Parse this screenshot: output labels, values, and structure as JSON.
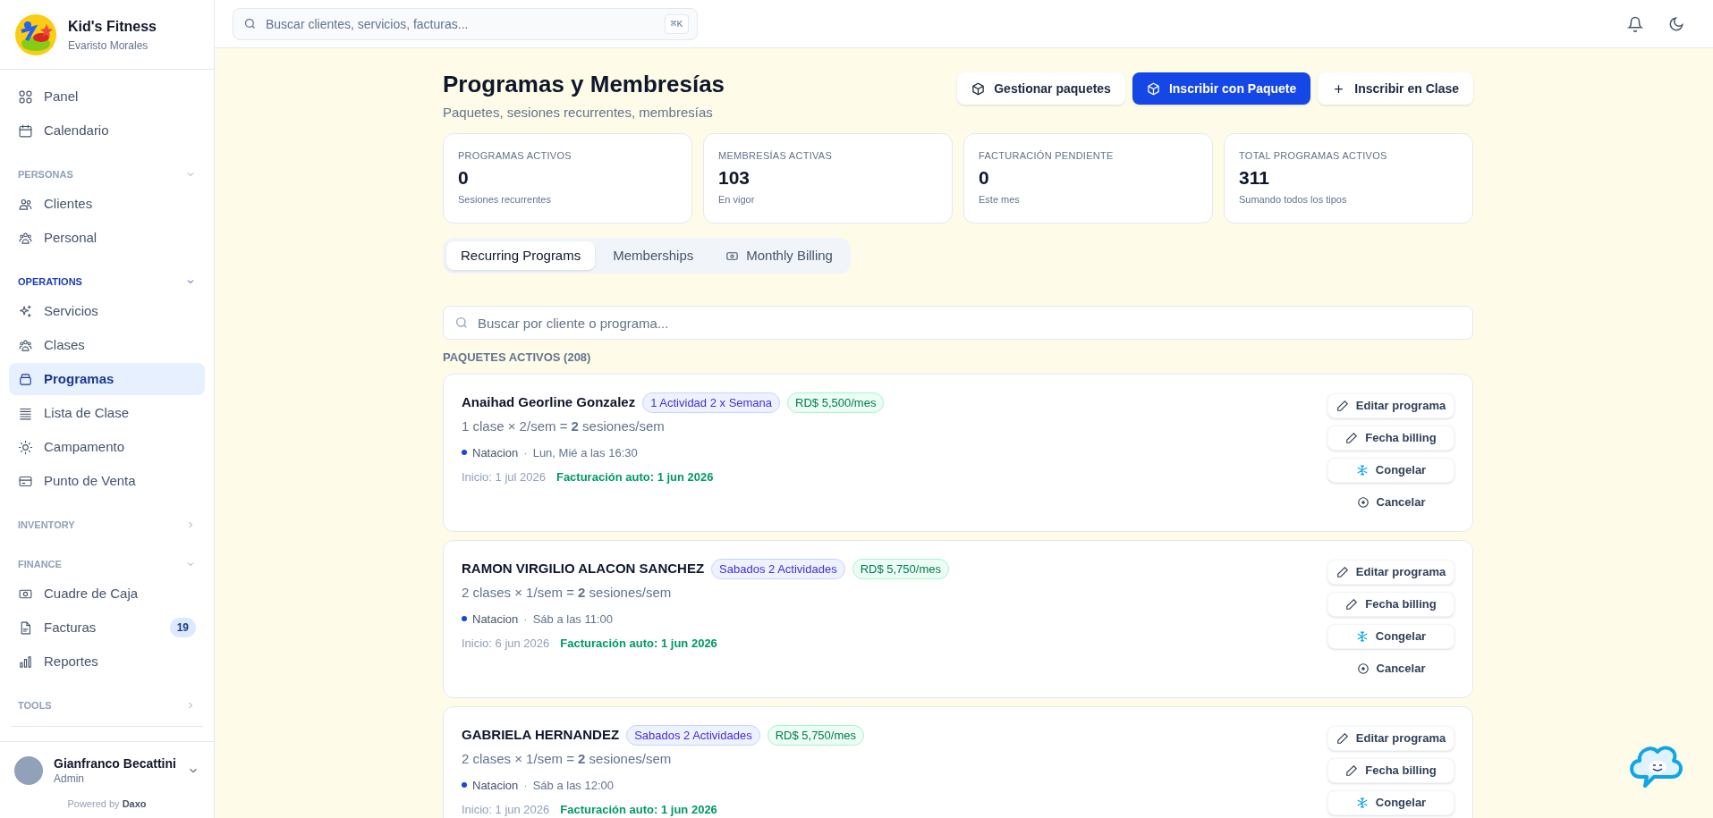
{
  "brand": {
    "name": "Kid's Fitness",
    "subtitle": "Evaristo Morales"
  },
  "sidebar": {
    "items": [
      {
        "label": "Panel",
        "selected": false
      },
      {
        "label": "Calendario",
        "selected": false
      }
    ],
    "sections": [
      {
        "title": "PERSONAS",
        "expanded": true,
        "items": [
          {
            "label": "Clientes",
            "selected": false
          },
          {
            "label": "Personal",
            "selected": false
          }
        ]
      },
      {
        "title": "OPERATIONS",
        "expanded": true,
        "items": [
          {
            "label": "Servicios",
            "selected": false
          },
          {
            "label": "Clases",
            "selected": false
          },
          {
            "label": "Programas",
            "selected": true
          },
          {
            "label": "Lista de Clase",
            "selected": false
          },
          {
            "label": "Campamento",
            "selected": false
          },
          {
            "label": "Punto de Venta",
            "selected": false
          }
        ]
      },
      {
        "title": "INVENTORY",
        "expanded": false
      },
      {
        "title": "FINANCE",
        "expanded": true,
        "items": [
          {
            "label": "Cuadre de Caja",
            "selected": false
          },
          {
            "label": "Facturas",
            "selected": false,
            "badge": "19"
          },
          {
            "label": "Reportes",
            "selected": false
          }
        ]
      },
      {
        "title": "TOOLS",
        "expanded": false
      }
    ]
  },
  "user": {
    "name": "Gianfranco Becattini",
    "role": "Admin"
  },
  "powered_by": {
    "prefix": "Powered by",
    "brand": "Daxo"
  },
  "topbar": {
    "search": {
      "placeholder": "Buscar clientes, servicios, facturas...",
      "shortcut": "⌘K"
    }
  },
  "page": {
    "title": "Programas y Membresías",
    "subtitle": "Paquetes, sesiones recurrentes, membresías",
    "actions": [
      {
        "label": "Gestionar paquetes",
        "kind": "secondary"
      },
      {
        "label": "Inscribir con Paquete",
        "kind": "primary"
      },
      {
        "label": "Inscribir en Clase",
        "kind": "add"
      }
    ]
  },
  "stats": [
    {
      "label": "PROGRAMAS ACTIVOS",
      "value": "0",
      "caption": "Sesiones recurrentes"
    },
    {
      "label": "MEMBRESÍAS ACTIVAS",
      "value": "103",
      "caption": "En vigor"
    },
    {
      "label": "FACTURACIÓN PENDIENTE",
      "value": "0",
      "caption": "Este mes"
    },
    {
      "label": "TOTAL PROGRAMAS ACTIVOS",
      "value": "311",
      "caption": "Sumando todos los tipos"
    }
  ],
  "tabs": [
    {
      "label": "Recurring Programs",
      "selected": true,
      "kind": "plain"
    },
    {
      "label": "Memberships",
      "selected": false,
      "kind": "plain"
    },
    {
      "label": "Monthly Billing",
      "selected": false,
      "kind": "icon"
    }
  ],
  "list_search": {
    "placeholder": "Buscar por cliente o programa..."
  },
  "list_heading": "PAQUETES ACTIVOS (208)",
  "programs": [
    {
      "name": "Anaihad Georline Gonzalez",
      "package": "1 Actividad 2 x Semana",
      "price": "RD$ 5,500/mes",
      "formula": "1 clase × 2/sem = **2** sesiones/sem",
      "activity": "Natacion",
      "separator": "·",
      "schedule": "Lun, Mié a las 16:30",
      "start": "Inicio: 1 jul 2026",
      "billing": "Facturación auto: 1 jun 2026",
      "actions": [
        {
          "label": "Editar programa",
          "kind": "edit"
        },
        {
          "label": "Fecha billing",
          "kind": "date"
        },
        {
          "label": "Congelar",
          "kind": "freeze"
        },
        {
          "label": "Cancelar",
          "kind": "cancel"
        }
      ]
    },
    {
      "name": "RAMON VIRGILIO ALACON SANCHEZ",
      "package": "Sabados 2 Actividades",
      "price": "RD$ 5,750/mes",
      "formula": "2 clases × 1/sem = **2** sesiones/sem",
      "activity": "Natacion",
      "separator": "·",
      "schedule": "Sáb a las 11:00",
      "start": "Inicio: 6 jun 2026",
      "billing": "Facturación auto: 1 jun 2026",
      "actions": [
        {
          "label": "Editar programa",
          "kind": "edit"
        },
        {
          "label": "Fecha billing",
          "kind": "date"
        },
        {
          "label": "Congelar",
          "kind": "freeze"
        },
        {
          "label": "Cancelar",
          "kind": "cancel"
        }
      ]
    },
    {
      "name": "GABRIELA HERNANDEZ",
      "package": "Sabados 2 Actividades",
      "price": "RD$ 5,750/mes",
      "formula": "2 clases × 1/sem = **2** sesiones/sem",
      "activity": "Natacion",
      "separator": "·",
      "schedule": "Sáb a las 12:00",
      "start": "Inicio: 1 jun 2026",
      "billing": "Facturación auto: 1 jun 2026",
      "actions": [
        {
          "label": "Editar programa",
          "kind": "edit"
        },
        {
          "label": "Fecha billing",
          "kind": "date"
        },
        {
          "label": "Congelar",
          "kind": "freeze"
        }
      ]
    }
  ]
}
